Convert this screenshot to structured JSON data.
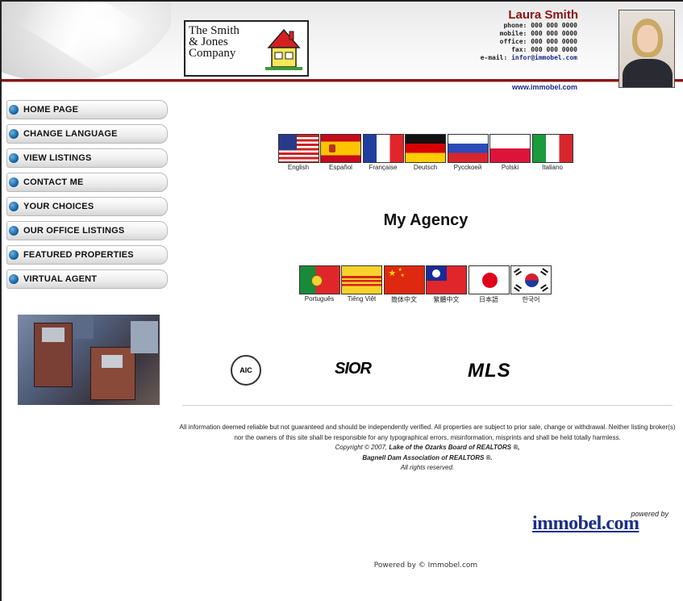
{
  "header": {
    "agent_name": "Laura Smith",
    "contact": [
      {
        "label": "phone:",
        "value": "000 000 0000"
      },
      {
        "label": "mobile:",
        "value": "000 000 0000"
      },
      {
        "label": "office:",
        "value": "000 000 0000"
      },
      {
        "label": "fax:",
        "value": "000 000 0000"
      },
      {
        "label": "e-mail:",
        "value": "infor@immobel.com"
      }
    ],
    "website": "www.immobel.com",
    "logo_text": "The Smith\n& Jones\n       Company",
    "accent_color": "#8b1414",
    "link_color": "#1a2a88"
  },
  "nav": {
    "items": [
      "HOME PAGE",
      "CHANGE LANGUAGE",
      "VIEW LISTINGS",
      "CONTACT ME",
      "YOUR CHOICES",
      "OUR OFFICE LISTINGS",
      "FEATURED PROPERTIES",
      "VIRTUAL AGENT"
    ]
  },
  "languages_row1": [
    {
      "label": "English",
      "flag": "us-flag-icon"
    },
    {
      "label": "Español",
      "flag": "spain-flag-icon"
    },
    {
      "label": "Française",
      "flag": "france-flag-icon"
    },
    {
      "label": "Deutsch",
      "flag": "germany-flag-icon"
    },
    {
      "label": "Pycckoeй",
      "flag": "russia-flag-icon"
    },
    {
      "label": "Polski",
      "flag": "poland-flag-icon"
    },
    {
      "label": "Italiano",
      "flag": "italy-flag-icon"
    }
  ],
  "languages_row2": [
    {
      "label": "Português",
      "flag": "portugal-flag-icon"
    },
    {
      "label": "Tiếng Việt",
      "flag": "vietnam-flag-icon"
    },
    {
      "label": "簡体中文",
      "flag": "china-flag-icon"
    },
    {
      "label": "繁體中文",
      "flag": "taiwan-flag-icon"
    },
    {
      "label": "日本語",
      "flag": "japan-flag-icon"
    },
    {
      "label": "한국어",
      "flag": "korea-flag-icon"
    }
  ],
  "main": {
    "title": "My Agency"
  },
  "assoc": {
    "aic": "AIC",
    "sior": "SIOR",
    "mls": "MLS"
  },
  "disclaimer": {
    "text": "All information deemed reliable but not guaranteed and should be independently verified. All properties are subject to prior sale, change or withdrawal. Neither listing broker(s) nor the owners of this site shall be responsible for any typographical errors, misinformation, misprints and shall be held totally harmless.",
    "copyright_prefix": "Copyright © 2007,",
    "org1": "Lake of the Ozarks Board of REALTORS ®,",
    "org2": "Bagnell Dam Association of REALTORS ®.",
    "rights": "All rights reserved."
  },
  "branding": {
    "powered_by": "powered by",
    "immobel": "immobel.com",
    "footer": "Powered by © Immobel.com"
  }
}
